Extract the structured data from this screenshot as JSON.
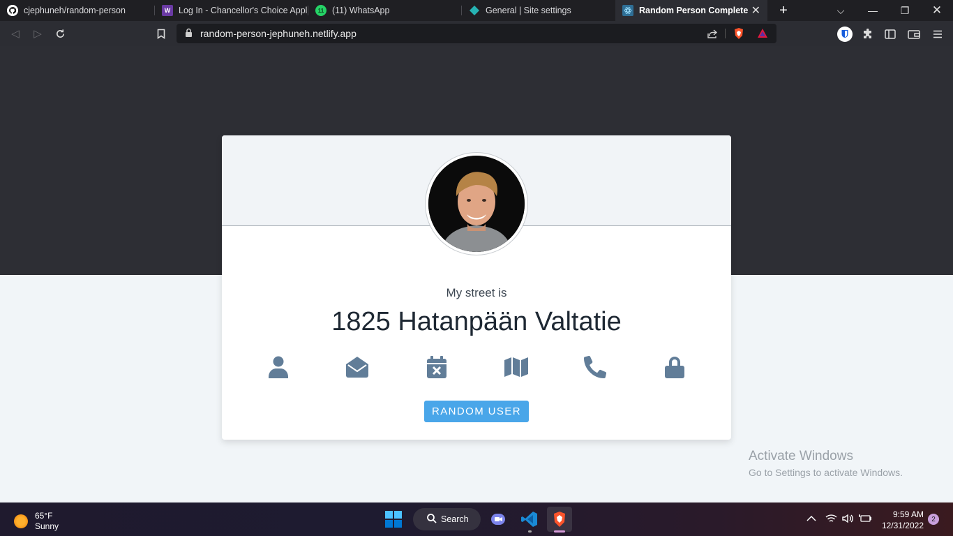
{
  "browser": {
    "tabs": [
      {
        "title": "cjephuneh/random-person",
        "icon": "github-icon"
      },
      {
        "title": "Log In - Chancellor's Choice Applic",
        "icon": "wordpress-icon"
      },
      {
        "title": "(11) WhatsApp",
        "icon": "whatsapp-icon",
        "badge": "11"
      },
      {
        "title": "General | Site settings",
        "icon": "netlify-icon"
      },
      {
        "title": "Random Person Complete",
        "icon": "react-icon"
      }
    ],
    "new_tab": "+",
    "url": "random-person-jephuneh.netlify.app"
  },
  "page": {
    "label": "My street is",
    "value": "1825 Hatanpään Valtatie",
    "icons": [
      "user-icon",
      "envelope-open-icon",
      "calendar-times-icon",
      "map-icon",
      "phone-icon",
      "lock-icon"
    ],
    "button_label": "RANDOM USER",
    "accent_color": "#49a6e9",
    "icon_color": "#617d98"
  },
  "watermark": {
    "line1": "Activate Windows",
    "line2": "Go to Settings to activate Windows."
  },
  "taskbar": {
    "temperature": "65°F",
    "condition": "Sunny",
    "search_label": "Search",
    "time": "9:59 AM",
    "date": "12/31/2022",
    "notification_count": "2"
  }
}
